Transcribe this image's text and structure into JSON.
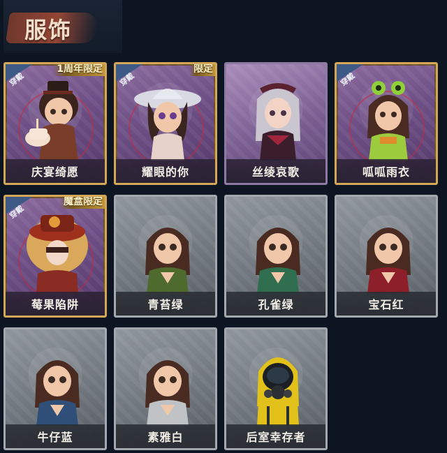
{
  "header": {
    "title": "服饰"
  },
  "badge_text": "穿戴",
  "cards": [
    {
      "label": "庆宴绮愿",
      "tag": "1周年限定",
      "worn": true,
      "style": "owned"
    },
    {
      "label": "耀眼的你",
      "tag": "限定",
      "worn": true,
      "style": "owned"
    },
    {
      "label": "丝绫哀歌",
      "tag": "",
      "worn": false,
      "style": "plain-purple"
    },
    {
      "label": "呱呱雨衣",
      "tag": "",
      "worn": true,
      "style": "owned"
    },
    {
      "label": "莓果陷阱",
      "tag": "魔盒限定",
      "worn": true,
      "style": "owned"
    },
    {
      "label": "青苔绿",
      "tag": "",
      "worn": false,
      "style": "gray"
    },
    {
      "label": "孔雀绿",
      "tag": "",
      "worn": false,
      "style": "gray"
    },
    {
      "label": "宝石红",
      "tag": "",
      "worn": false,
      "style": "gray"
    },
    {
      "label": "牛仔蓝",
      "tag": "",
      "worn": false,
      "style": "gray"
    },
    {
      "label": "素雅白",
      "tag": "",
      "worn": false,
      "style": "gray"
    },
    {
      "label": "后室幸存者",
      "tag": "",
      "worn": false,
      "style": "gray"
    }
  ],
  "colors": {
    "hair": "#4a2b22",
    "skin": "#f1c7a9",
    "moss_green": "#4e6a2c",
    "peacock_green": "#2f6e4e",
    "ruby_red": "#8c1f2a",
    "denim_blue": "#2f4e78",
    "plain_white": "#bfc3c6",
    "hazmat_yellow": "#e2c21a"
  }
}
